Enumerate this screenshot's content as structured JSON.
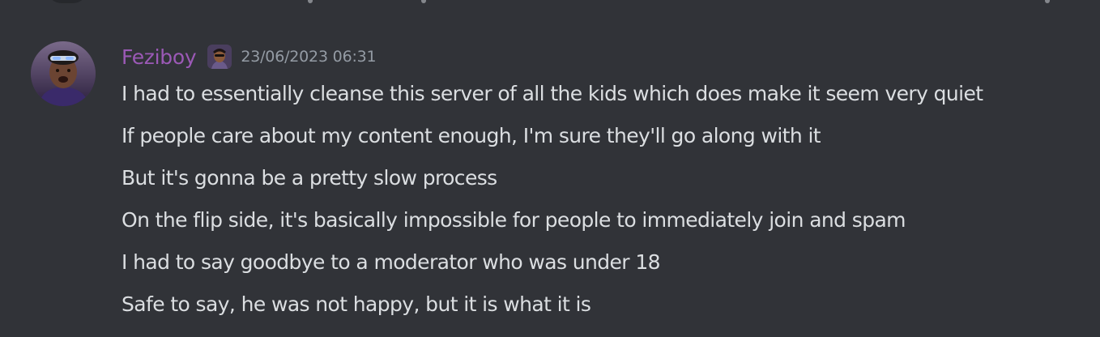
{
  "message": {
    "author": {
      "username": "Feziboy",
      "color": "#9b59b6",
      "avatar_icon": "user-avatar",
      "role_icon": "role-avatar-icon"
    },
    "timestamp": "23/06/2023 06:31",
    "lines": [
      "I had to essentially cleanse this server of all the kids which does make it seem very quiet",
      "If people care about my content enough, I'm sure they'll go along with it",
      "But it's gonna be a pretty slow process",
      "On the flip side, it's basically impossible for people to immediately join and spam",
      "I had to say goodbye to a moderator who was under 18",
      "Safe to say, he was not happy, but it is what it is"
    ]
  },
  "colors": {
    "background": "#313338",
    "text": "#dbdee1",
    "timestamp": "#949ba4"
  }
}
